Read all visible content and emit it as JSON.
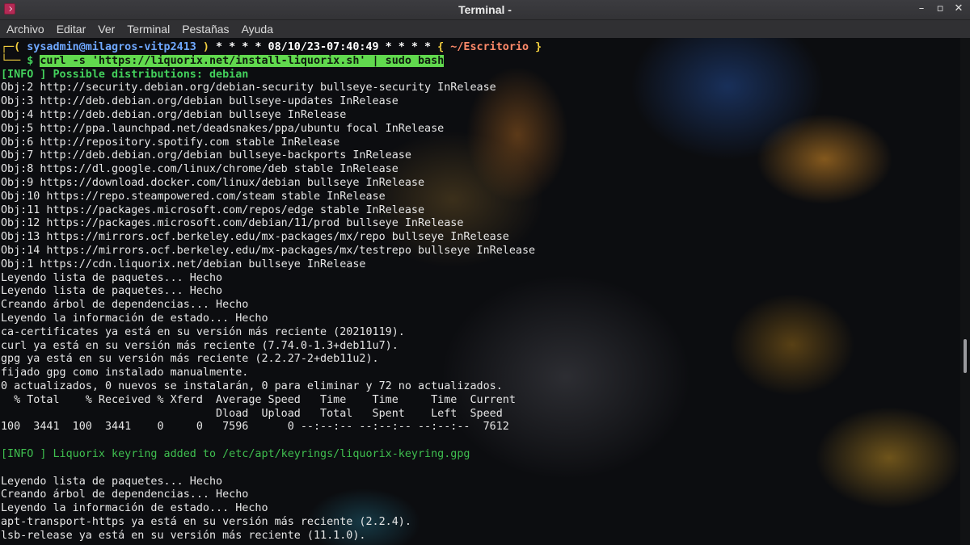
{
  "window": {
    "title": "Terminal -",
    "controls": {
      "minimize": "–",
      "maximize": "▫",
      "close": "✕"
    }
  },
  "menu": {
    "items": [
      "Archivo",
      "Editar",
      "Ver",
      "Terminal",
      "Pestañas",
      "Ayuda"
    ]
  },
  "prompt": {
    "box_top": "┌─(",
    "user_host": "sysadmin@milagros-vitp2413",
    "after_host": ")",
    "stars_left": "* * * *",
    "datetime": "08/10/23-07:40:49",
    "stars_right": "* * * *",
    "dir_open": "{",
    "dir": "~/Escritorio",
    "dir_close": "}",
    "box_bottom": "└──",
    "dollar": "$",
    "command": "curl -s 'https://liquorix.net/install-liquorix.sh' | sudo bash"
  },
  "output": {
    "info_distributions": "[INFO ] Possible distributions: debian",
    "repo_lines": [
      "Obj:2 http://security.debian.org/debian-security bullseye-security InRelease",
      "Obj:3 http://deb.debian.org/debian bullseye-updates InRelease",
      "Obj:4 http://deb.debian.org/debian bullseye InRelease",
      "Obj:5 http://ppa.launchpad.net/deadsnakes/ppa/ubuntu focal InRelease",
      "Obj:6 http://repository.spotify.com stable InRelease",
      "Obj:7 http://deb.debian.org/debian bullseye-backports InRelease",
      "Obj:8 https://dl.google.com/linux/chrome/deb stable InRelease",
      "Obj:9 https://download.docker.com/linux/debian bullseye InRelease",
      "Obj:10 https://repo.steampowered.com/steam stable InRelease",
      "Obj:11 https://packages.microsoft.com/repos/edge stable InRelease",
      "Obj:12 https://packages.microsoft.com/debian/11/prod bullseye InRelease",
      "Obj:13 https://mirrors.ocf.berkeley.edu/mx-packages/mx/repo bullseye InRelease",
      "Obj:14 https://mirrors.ocf.berkeley.edu/mx-packages/mx/testrepo bullseye InRelease",
      "Obj:1 https://cdn.liquorix.net/debian bullseye InRelease"
    ],
    "apt_lines_1": [
      "Leyendo lista de paquetes... Hecho",
      "Leyendo lista de paquetes... Hecho",
      "Creando árbol de dependencias... Hecho",
      "Leyendo la información de estado... Hecho",
      "ca-certificates ya está en su versión más reciente (20210119).",
      "curl ya está en su versión más reciente (7.74.0-1.3+deb11u7).",
      "gpg ya está en su versión más reciente (2.2.27-2+deb11u2).",
      "fijado gpg como instalado manualmente.",
      "0 actualizados, 0 nuevos se instalarán, 0 para eliminar y 72 no actualizados."
    ],
    "curl_header_1": "  % Total    % Received % Xferd  Average Speed   Time    Time     Time  Current",
    "curl_header_2": "                                 Dload  Upload   Total   Spent    Left  Speed",
    "curl_progress": "100  3441  100  3441    0     0   7596      0 --:--:-- --:--:-- --:--:--  7612",
    "info_keyring": "[INFO ] Liquorix keyring added to /etc/apt/keyrings/liquorix-keyring.gpg",
    "apt_lines_2": [
      "Leyendo lista de paquetes... Hecho",
      "Creando árbol de dependencias... Hecho",
      "Leyendo la información de estado... Hecho",
      "apt-transport-https ya está en su versión más reciente (2.2.4).",
      "lsb-release ya está en su versión más reciente (11.1.0)."
    ]
  },
  "colors": {
    "prompt_box": "#f4d03f",
    "user_host": "#6fa8ff",
    "directory": "#ff8a6a",
    "info": "#43d15c",
    "command_highlight": "#61d94e"
  },
  "icons": {
    "app": "terminal-app-icon"
  }
}
